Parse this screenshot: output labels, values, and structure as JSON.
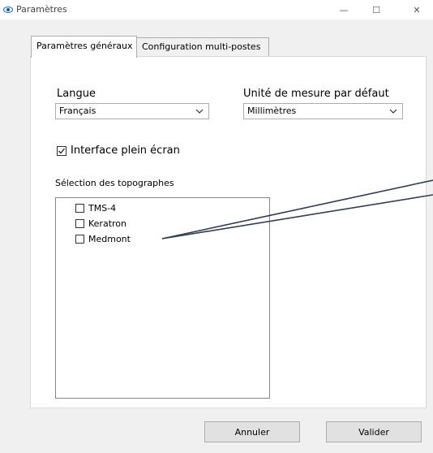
{
  "window": {
    "title": "Paramètres",
    "minimize": "—",
    "maximize": "☐",
    "close": "✕"
  },
  "tabs": [
    {
      "label": "Paramètres généraux",
      "active": true
    },
    {
      "label": "Configuration multi-postes",
      "active": false
    }
  ],
  "language": {
    "label": "Langue",
    "value": "Français"
  },
  "unit": {
    "label": "Unité de mesure par défaut",
    "value": "Millimètres"
  },
  "fullscreen": {
    "label": "Interface plein écran",
    "checked": true
  },
  "topographers": {
    "label": "Sélection des topographes",
    "items": [
      {
        "label": "TMS-4",
        "checked": false
      },
      {
        "label": "Keratron",
        "checked": false
      },
      {
        "label": "Medmont",
        "checked": false
      }
    ]
  },
  "buttons": {
    "cancel": "Annuler",
    "ok": "Valider"
  },
  "colors": {
    "icon_blue": "#1e6fc8",
    "pointer_line": "#333f50"
  },
  "icons": {
    "app": "eye-icon",
    "dropdown": "chevron-down-icon",
    "check": "checkmark-icon"
  }
}
